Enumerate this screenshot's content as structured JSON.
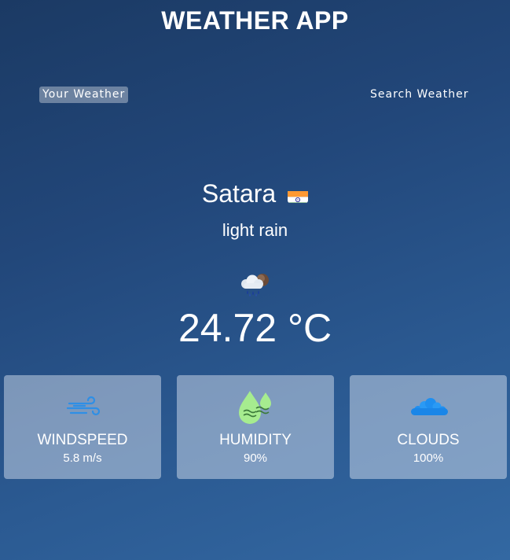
{
  "header": {
    "title": "WEATHER APP"
  },
  "tabs": [
    {
      "label": "Your Weather",
      "active": true
    },
    {
      "label": "Search Weather",
      "active": false
    }
  ],
  "current": {
    "city": "Satara",
    "country_flag_icon": "india-flag-icon",
    "description": "light rain",
    "weather_icon": "cloud-rain-icon",
    "temperature": "24.72 °C"
  },
  "stats": [
    {
      "label": "WINDSPEED",
      "value": "5.8 m/s",
      "icon": "wind-icon"
    },
    {
      "label": "HUMIDITY",
      "value": "90%",
      "icon": "humidity-icon"
    },
    {
      "label": "CLOUDS",
      "value": "100%",
      "icon": "cloud-icon"
    }
  ],
  "colors": {
    "background_top": "#1b3a64",
    "background_bottom": "#3368a2",
    "wind_icon": "#2e8fe6",
    "humidity_icon": "#a6ec8f",
    "cloud_icon": "#1f8ff0"
  }
}
